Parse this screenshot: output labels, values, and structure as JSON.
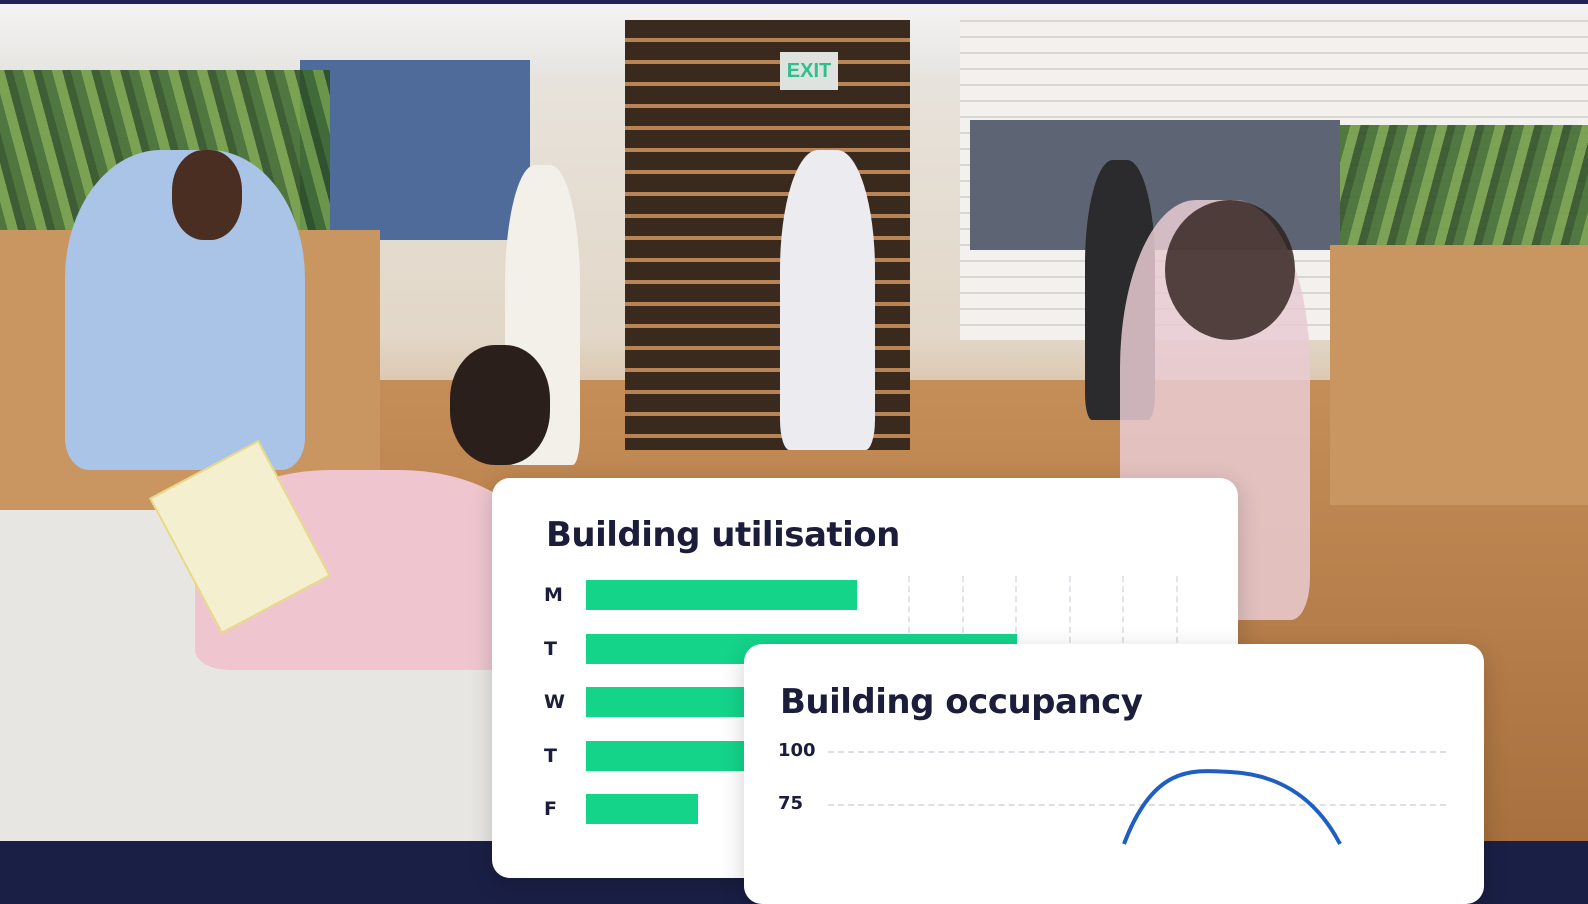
{
  "background": {
    "scene": "office",
    "exit_sign": "EXIT",
    "colors": {
      "top_band": "#1f2355",
      "wall_blue": "#4f6b99",
      "floor": "#b47a45"
    }
  },
  "utilisation_card": {
    "title": "Building utilisation",
    "chart_data": {
      "type": "bar",
      "orientation": "horizontal",
      "title": "Building utilisation",
      "categories": [
        "M",
        "T",
        "W",
        "T",
        "F"
      ],
      "values": [
        46,
        73,
        46,
        46,
        19
      ],
      "bar_color": "#14d48a",
      "grid": true
    }
  },
  "occupancy_card": {
    "title": "Building occupancy",
    "chart_data": {
      "type": "line",
      "title": "Building occupancy",
      "y_ticks": [
        "100",
        "75"
      ],
      "ylim": [
        0,
        100
      ],
      "grid": true,
      "line_color": "#1f5fc4"
    }
  }
}
